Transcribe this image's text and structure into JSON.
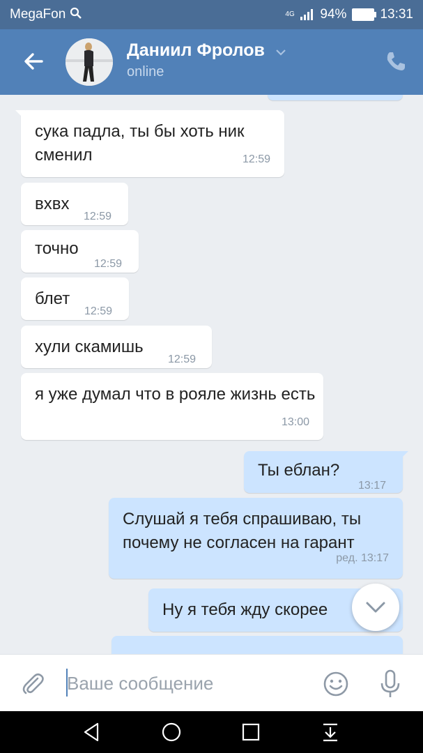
{
  "status_bar": {
    "carrier": "MegaFon",
    "network": "4G",
    "battery": "94%",
    "time": "13:31"
  },
  "header": {
    "contact_name": "Даниил Фролов",
    "presence": "online"
  },
  "messages": [
    {
      "dir": "in",
      "text": "сука падла, ты бы хоть ник сменил",
      "time": "12:59"
    },
    {
      "dir": "in",
      "text": "вхвх",
      "time": "12:59"
    },
    {
      "dir": "in",
      "text": "точно",
      "time": "12:59"
    },
    {
      "dir": "in",
      "text": "блет",
      "time": "12:59"
    },
    {
      "dir": "in",
      "text": "хули скамишь",
      "time": "12:59"
    },
    {
      "dir": "in",
      "text": "я уже думал что в рояле жизнь есть",
      "time": "13:00"
    },
    {
      "dir": "out",
      "text": "Ты еблан?",
      "time": "13:17"
    },
    {
      "dir": "out",
      "text": "Слушай я тебя спрашиваю, ты почему не согласен на гарант",
      "time": "ред. 13:17"
    },
    {
      "dir": "out",
      "text": "Ну я тебя жду скорее",
      "time": ""
    }
  ],
  "composer": {
    "placeholder": "Ваше сообщение"
  },
  "icons": {
    "back": "arrow-left-icon",
    "call": "phone-icon",
    "attach": "paperclip-icon",
    "emoji": "smile-icon",
    "voice": "microphone-icon",
    "scroll": "chevron-down-icon"
  },
  "colors": {
    "header": "#5181b8",
    "status_bar": "#4a6d96",
    "outgoing_bubble": "#cce4ff",
    "incoming_bubble": "#ffffff",
    "chat_bg": "#ebeef2"
  }
}
